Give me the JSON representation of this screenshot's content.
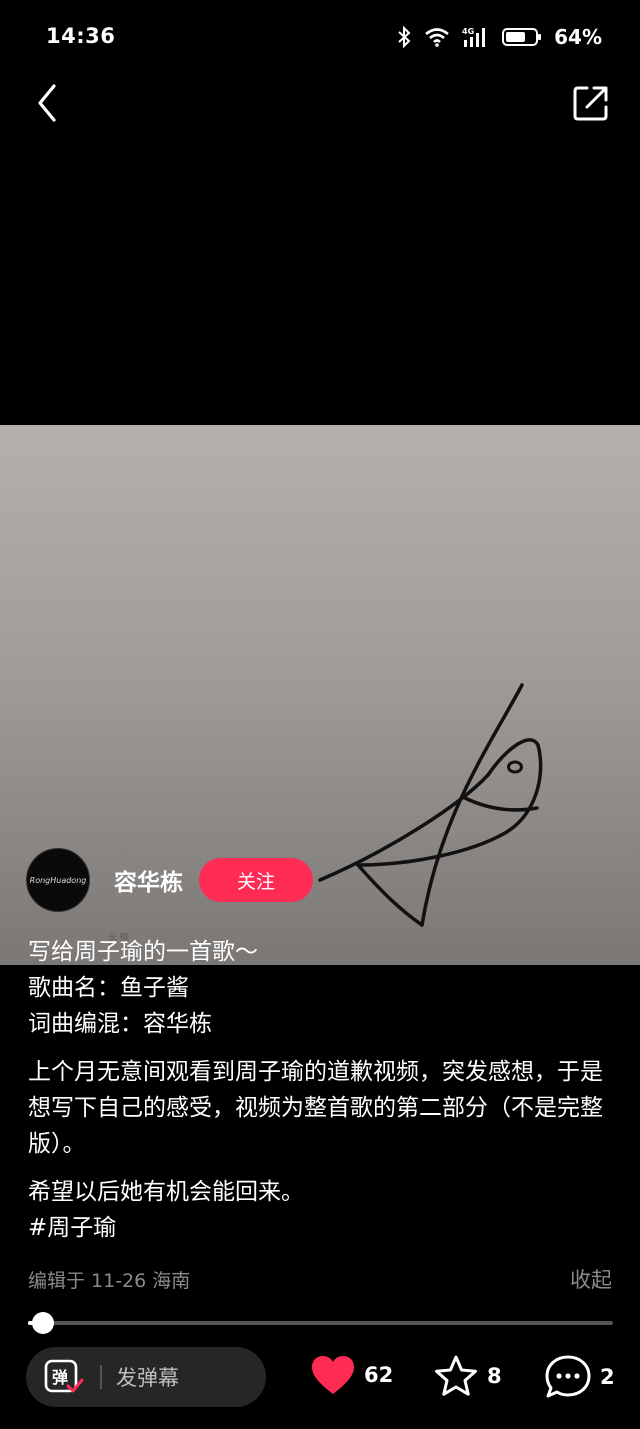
{
  "status": {
    "time": "14:36",
    "battery": "64%"
  },
  "video": {
    "watermark": "长 柳"
  },
  "author": {
    "avatar_text": "RongHuadong",
    "name": "容华栋",
    "follow_label": "关注"
  },
  "caption": {
    "line1": "写给周子瑜的一首歌～",
    "line2": "歌曲名：鱼子酱",
    "line3": "词曲编混：容华栋",
    "para2": "上个月无意间观看到周子瑜的道歉视频，突发感想，于是想写下自己的感受，视频为整首歌的第二部分（不是完整版）。",
    "para3": "希望以后她有机会能回来。",
    "hashtag": "#周子瑜"
  },
  "meta": {
    "edit_info": "编辑于 11-26 海南",
    "collapse_label": "收起"
  },
  "progress": {
    "fraction": 0.025
  },
  "bottom": {
    "danmu_placeholder": "发弹幕",
    "danmu_icon_char": "弹",
    "likes": "62",
    "favorites": "8",
    "comments": "2"
  },
  "colors": {
    "accent": "#fe2c55",
    "like": "#fe2c55"
  }
}
